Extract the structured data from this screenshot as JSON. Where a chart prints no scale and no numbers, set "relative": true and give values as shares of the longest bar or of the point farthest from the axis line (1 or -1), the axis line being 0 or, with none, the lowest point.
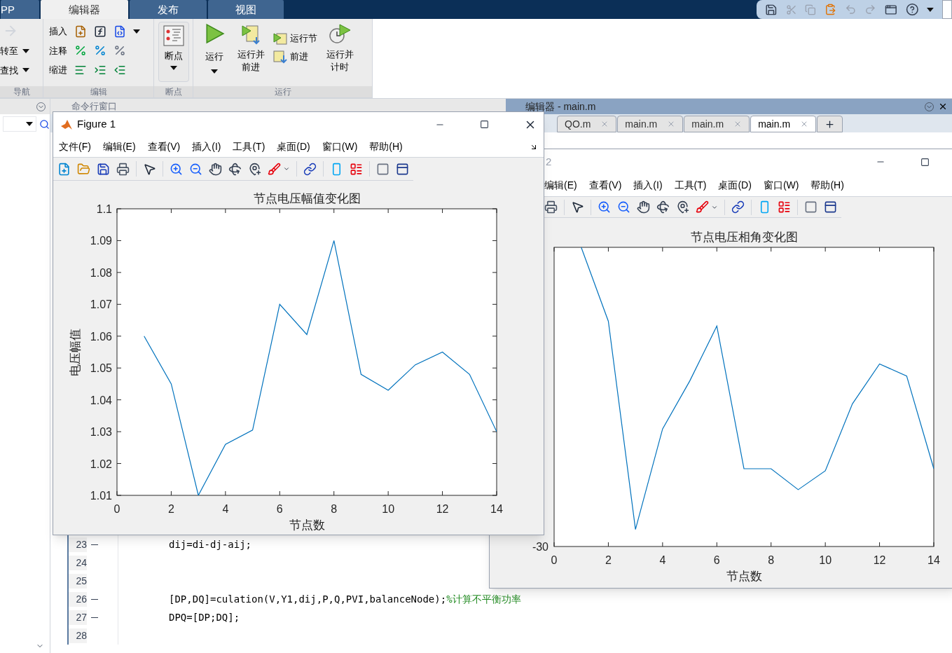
{
  "ribbon": {
    "tabs": [
      {
        "label": "PP",
        "selected": false
      },
      {
        "label": "编辑器",
        "selected": true
      },
      {
        "label": "发布",
        "selected": false
      },
      {
        "label": "视图",
        "selected": false
      }
    ],
    "groups": [
      {
        "kind": "nav",
        "label": "导航",
        "items": [
          "转至",
          "查找"
        ]
      },
      {
        "kind": "edit",
        "label": "编辑",
        "items": [
          "插入",
          "注释",
          "缩进"
        ]
      },
      {
        "kind": "breakpoint",
        "label": "断点",
        "items": [
          "断点"
        ]
      },
      {
        "kind": "run",
        "label": "运行",
        "items": [
          "运行",
          "运行并前进",
          "运行节",
          "前进",
          "运行并计时"
        ]
      }
    ]
  },
  "command_window": {
    "title": "命令行窗口"
  },
  "editor": {
    "title": "编辑器 - main.m",
    "tabs": [
      {
        "label": "QO.m",
        "selected": false
      },
      {
        "label": "main.m",
        "selected": false
      },
      {
        "label": "main.m",
        "selected": false
      },
      {
        "label": "main.m",
        "selected": true
      }
    ],
    "lines": [
      {
        "number": "23",
        "breakable": true,
        "code": "dij=di-dj-aij;"
      },
      {
        "number": "24",
        "breakable": false
      },
      {
        "number": "25",
        "breakable": false
      },
      {
        "number": "26",
        "breakable": true,
        "code": "[DP,DQ]=culation(V,Y1,dij,P,Q,PVI,balanceNode);",
        "comment": "%计算不平衡功率"
      },
      {
        "number": "27",
        "breakable": true,
        "code": "DPQ=[DP;DQ];"
      },
      {
        "number": "28",
        "breakable": false
      }
    ]
  },
  "figures": [
    {
      "title": "Figure 1",
      "menu": [
        "文件(F)",
        "编辑(E)",
        "查看(V)",
        "插入(I)",
        "工具(T)",
        "桌面(D)",
        "窗口(W)",
        "帮助(H)"
      ],
      "chart_data": {
        "type": "line",
        "title": "节点电压幅值变化图",
        "xlabel": "节点数",
        "ylabel": "电压幅值",
        "x": [
          1,
          2,
          3,
          4,
          5,
          6,
          7,
          8,
          9,
          10,
          11,
          12,
          13,
          14
        ],
        "series": [
          {
            "color": "#0072bd",
            "values": [
              1.06,
              1.045,
              1.01,
              1.026,
              1.0305,
              1.07,
              1.0605,
              1.09,
              1.048,
              1.043,
              1.051,
              1.055,
              1.048,
              1.03
            ]
          }
        ],
        "xlim": [
          0,
          14
        ],
        "ylim": [
          1.01,
          1.1
        ],
        "xticks": [
          0,
          2,
          4,
          6,
          8,
          10,
          12,
          14
        ],
        "yticks": [
          {
            "value": 1.01,
            "label": "1.01"
          },
          {
            "value": 1.02,
            "label": "1.02"
          },
          {
            "value": 1.03,
            "label": "1.03"
          },
          {
            "value": 1.04,
            "label": "1.04"
          },
          {
            "value": 1.05,
            "label": "1.05"
          },
          {
            "value": 1.06,
            "label": "1.06"
          },
          {
            "value": 1.07,
            "label": "1.07"
          },
          {
            "value": 1.08,
            "label": "1.08"
          },
          {
            "value": 1.09,
            "label": "1.09"
          },
          {
            "value": 1.1,
            "label": "1.1"
          }
        ]
      }
    },
    {
      "title": "2",
      "menu": [
        "编辑(E)",
        "查看(V)",
        "插入(I)",
        "工具(T)",
        "桌面(D)",
        "窗口(W)",
        "帮助(H)"
      ],
      "chart_data": {
        "type": "line",
        "title": "节点电压相角变化图",
        "xlabel": "节点数",
        "x": [
          1,
          2,
          3,
          4,
          5,
          6,
          7,
          8,
          9,
          10,
          11,
          12,
          13,
          14
        ],
        "series": [
          {
            "color": "#0072bd",
            "values": [
              1,
              0.753,
              0.057,
              0.393,
              0.553,
              0.737,
              0.26,
              0.26,
              0.19,
              0.253,
              0.477,
              0.61,
              0.57,
              0.26
            ]
          }
        ],
        "xlim": [
          0,
          14
        ],
        "xticks": [
          0,
          2,
          4,
          6,
          8,
          10,
          12,
          14
        ],
        "relative": true,
        "annotations": [
          {
            "text": "-30"
          }
        ]
      }
    }
  ]
}
